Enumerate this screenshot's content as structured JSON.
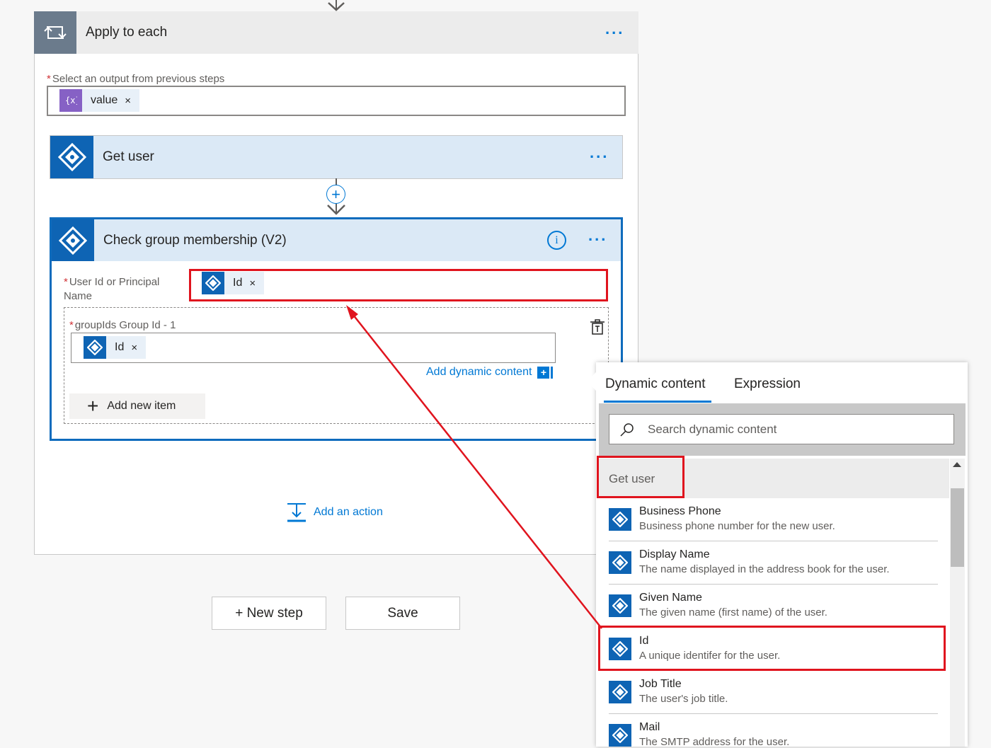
{
  "apply_each": {
    "title": "Apply to each",
    "more": "...",
    "select_label": "Select an output from previous steps",
    "required_mark": "*",
    "token_label": "value",
    "remove_mark": "×"
  },
  "get_user": {
    "title": "Get user",
    "more": "..."
  },
  "check_group": {
    "title": "Check group membership (V2)",
    "more": "...",
    "user_label": "User Id or Principal Name",
    "user_token": "Id",
    "group_label": "groupIds Group Id - 1",
    "group_token": "Id",
    "add_dynamic": "Add dynamic content",
    "add_item": "Add new item",
    "remove_mark": "×",
    "required_mark": "*"
  },
  "add_action": "Add an action",
  "buttons": {
    "new_step": "+ New step",
    "save": "Save"
  },
  "dynamic_panel": {
    "tabs": [
      "Dynamic content",
      "Expression"
    ],
    "search_placeholder": "Search dynamic content",
    "group": "Get user",
    "items": [
      {
        "name": "Business Phone",
        "desc": "Business phone number for the new user."
      },
      {
        "name": "Display Name",
        "desc": "The name displayed in the address book for the user."
      },
      {
        "name": "Given Name",
        "desc": "The given name (first name) of the user."
      },
      {
        "name": "Id",
        "desc": "A unique identifer for the user."
      },
      {
        "name": "Job Title",
        "desc": "The user's job title."
      },
      {
        "name": "Mail",
        "desc": "The SMTP address for the user."
      }
    ]
  },
  "colors": {
    "accent": "#0078d4",
    "azure_ad": "#0e64b4",
    "highlight": "#e0141e",
    "variable": "#8661c5"
  },
  "icons": [
    "loop-icon",
    "azure-ad-icon",
    "variable-icon",
    "info-icon",
    "delete-icon",
    "search-icon",
    "add-action-icon",
    "plus-icon"
  ]
}
